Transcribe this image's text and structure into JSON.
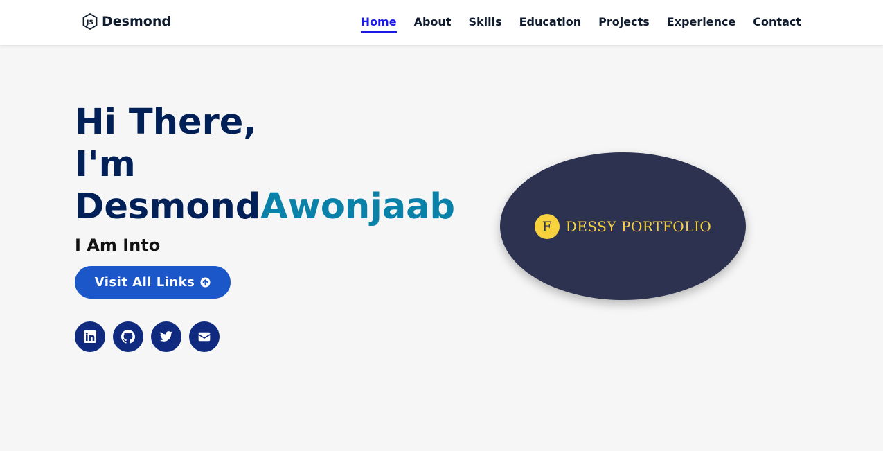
{
  "nav": {
    "brand": "Desmond",
    "brand_icon": "nodejs-icon",
    "links": [
      {
        "label": "Home",
        "active": true
      },
      {
        "label": "About"
      },
      {
        "label": "Skills"
      },
      {
        "label": "Education"
      },
      {
        "label": "Projects"
      },
      {
        "label": "Experience"
      },
      {
        "label": "Contact"
      }
    ]
  },
  "hero": {
    "greeting_line1": "Hi There,",
    "greeting_line2": "I'm",
    "first_name": "Desmond",
    "last_name": "Awonjaab",
    "into": "I Am Into",
    "cta_label": "Visit All Links",
    "cta_icon": "arrow-circle-up-icon",
    "socials": [
      {
        "name": "linkedin",
        "icon": "linkedin-icon"
      },
      {
        "name": "github",
        "icon": "github-icon"
      },
      {
        "name": "twitter",
        "icon": "twitter-icon"
      },
      {
        "name": "email",
        "icon": "envelope-icon"
      }
    ]
  },
  "profile_image": {
    "badge_letter": "F",
    "logo_text": "DESSY PORTFOLIO"
  },
  "colors": {
    "heading": "#002057",
    "accent": "#0a81a8",
    "button": "#1b57c9",
    "social_bg": "#0f2a7e",
    "nav_active": "#1a1ae6",
    "logo_gold": "#f7d23d",
    "logo_bg": "#2c3250"
  }
}
